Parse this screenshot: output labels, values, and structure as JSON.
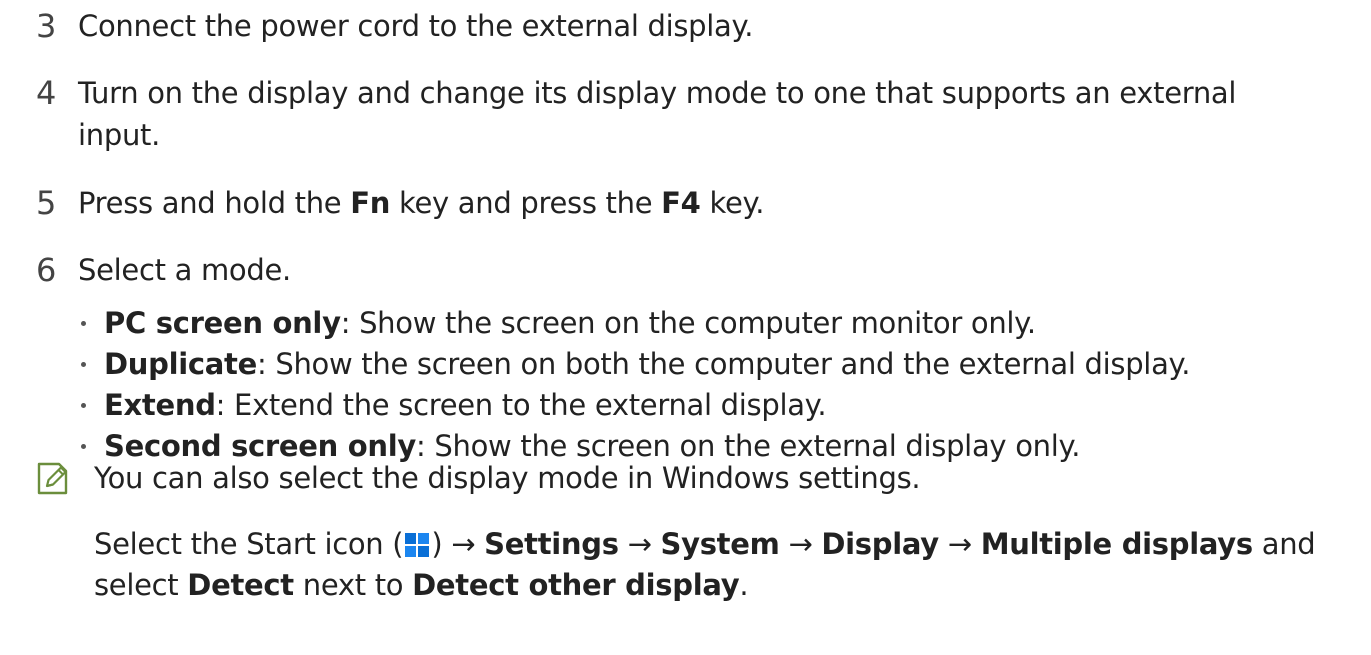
{
  "steps": [
    {
      "number": "3",
      "text": "Connect the power cord to the external display."
    },
    {
      "number": "4",
      "line1": "Turn on the display and change its display mode to one that supports an external",
      "line2": "input."
    },
    {
      "number": "5",
      "pre": "Press and hold the ",
      "key1": "Fn",
      "mid": " key and press the ",
      "key2": "F4",
      "post": " key."
    },
    {
      "number": "6",
      "text": "Select a mode."
    }
  ],
  "modes": [
    {
      "name": "PC screen only",
      "desc": ": Show the screen on the computer monitor only."
    },
    {
      "name": "Duplicate",
      "desc": ": Show the screen on both the computer and the external display."
    },
    {
      "name": "Extend",
      "desc": ": Extend the screen to the external display."
    },
    {
      "name": "Second screen only",
      "desc": ": Show the screen on the external display only."
    }
  ],
  "note": {
    "icon": "note-pencil-icon",
    "line1": "You can also select the display mode in Windows settings.",
    "line2": {
      "pre": "Select the Start icon (",
      "icon": "windows-start-icon",
      "after_icon": ") → ",
      "path1": "Settings",
      "arrow1": " → ",
      "path2": "System",
      "arrow2": " → ",
      "path3": "Display",
      "arrow3": " → ",
      "path4": "Multiple displays",
      "post": " and"
    },
    "line3": {
      "pre": "select ",
      "bold1": "Detect",
      "mid": " next to ",
      "bold2": "Detect other display",
      "post": "."
    }
  },
  "colors": {
    "text": "#222222",
    "number": "#444444",
    "icon_green": "#6b8e3c",
    "windows_blue": "#0a6fd6"
  }
}
